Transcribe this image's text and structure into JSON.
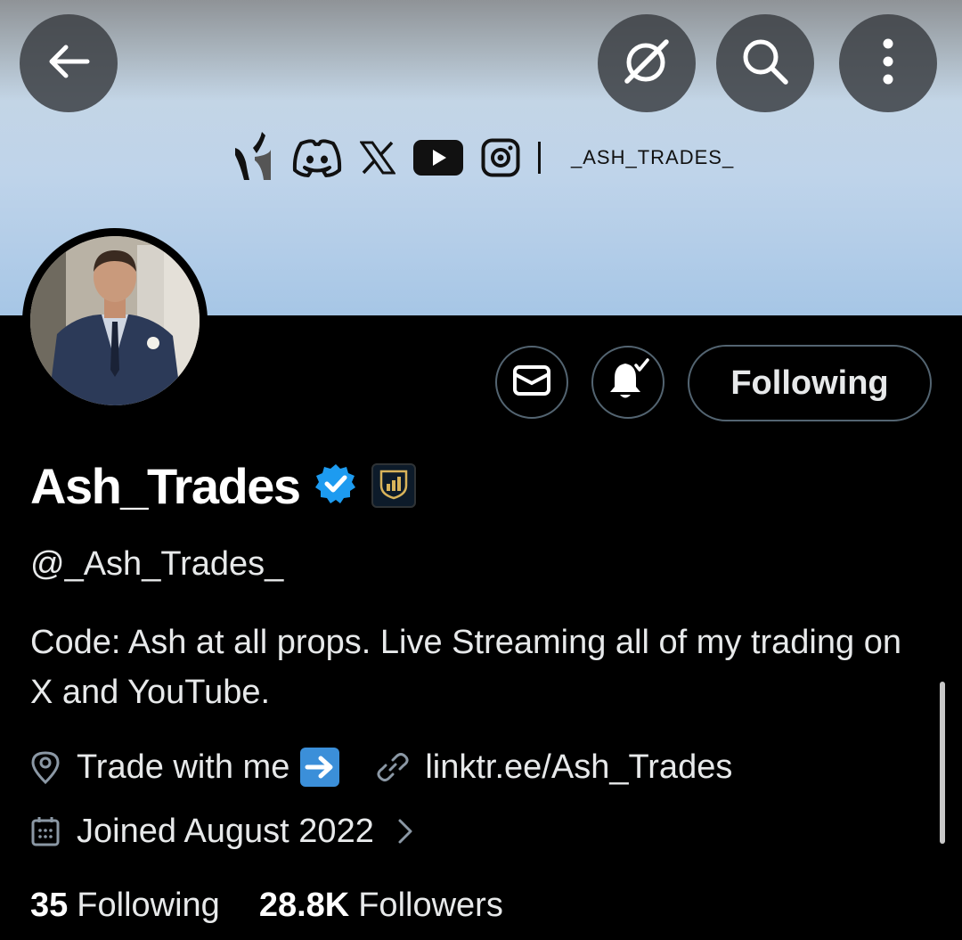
{
  "banner": {
    "social_icons": [
      "brand-logo-icon",
      "discord-icon",
      "x-icon",
      "youtube-icon",
      "instagram-icon"
    ],
    "handle_text": "_ASH_TRADES_"
  },
  "topbar": {
    "back_icon": "arrow-left-icon",
    "grok_icon": "grok-icon",
    "search_icon": "search-icon",
    "more_icon": "more-vertical-icon"
  },
  "profile": {
    "display_name": "Ash_Trades",
    "handle": "@_Ash_Trades_",
    "bio": "Code: Ash at all props. Live Streaming all of my trading on X and YouTube.",
    "location": "Trade with me",
    "location_emoji": "➡️",
    "link": "linktr.ee/Ash_Trades",
    "joined": "Joined August 2022",
    "following_count": "35",
    "following_label": "Following",
    "followers_count": "28.8K",
    "followers_label": "Followers"
  },
  "actions": {
    "follow_button_label": "Following"
  },
  "colors": {
    "background": "#000000",
    "verified_blue": "#1d9bf0",
    "text_primary": "#e7e9ea",
    "border": "#536471"
  }
}
